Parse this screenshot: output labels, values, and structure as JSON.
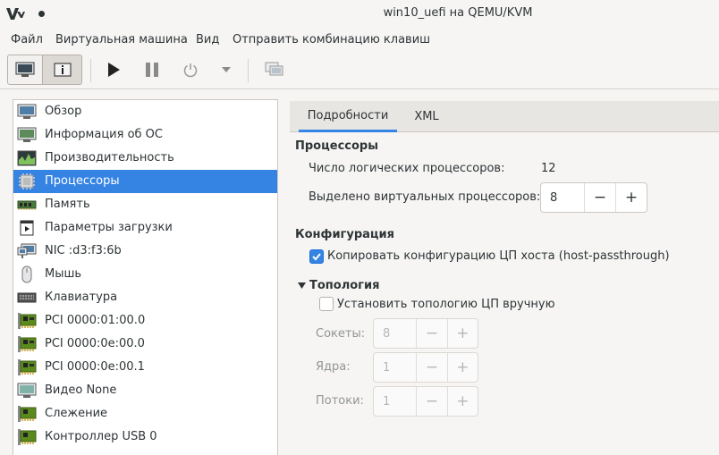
{
  "window": {
    "title": "win10_uefi на QEMU/KVM"
  },
  "menu": [
    "Файл",
    "Виртуальная машина",
    "Вид",
    "Отправить комбинацию клавиш"
  ],
  "toolbar": {
    "buttons": [
      "console-view",
      "details-view",
      "run",
      "pause",
      "shutdown",
      "shutdown-menu",
      "snapshots"
    ]
  },
  "sidebar": {
    "items": [
      {
        "label": "Обзор",
        "icon": "overview-monitor-icon"
      },
      {
        "label": "Информация об ОС",
        "icon": "os-info-monitor-icon"
      },
      {
        "label": "Производительность",
        "icon": "performance-graph-icon"
      },
      {
        "label": "Процессоры",
        "icon": "cpu-chip-icon",
        "selected": true
      },
      {
        "label": "Память",
        "icon": "memory-module-icon"
      },
      {
        "label": "Параметры загрузки",
        "icon": "boot-options-icon"
      },
      {
        "label": "NIC :d3:f3:6b",
        "icon": "network-nic-icon"
      },
      {
        "label": "Мышь",
        "icon": "mouse-icon"
      },
      {
        "label": "Клавиатура",
        "icon": "keyboard-icon"
      },
      {
        "label": "PCI 0000:01:00.0",
        "icon": "pci-card-icon"
      },
      {
        "label": "PCI 0000:0e:00.0",
        "icon": "pci-card-icon"
      },
      {
        "label": "PCI 0000:0e:00.1",
        "icon": "pci-card-icon"
      },
      {
        "label": "Видео None",
        "icon": "video-monitor-icon"
      },
      {
        "label": "Слежение",
        "icon": "tracking-card-icon"
      },
      {
        "label": "Контроллер USB 0",
        "icon": "usb-controller-icon"
      }
    ]
  },
  "tabs": [
    {
      "label": "Подробности",
      "active": true
    },
    {
      "label": "XML",
      "active": false
    }
  ],
  "processors": {
    "section_title": "Процессоры",
    "logical_label": "Число логических процессоров:",
    "logical_value": "12",
    "vcpu_label": "Выделено виртуальных процессоров:",
    "vcpu_value": "8",
    "minus": "−",
    "plus": "+"
  },
  "configuration": {
    "section_title": "Конфигурация",
    "copy_host_label": "Копировать конфигурацию ЦП хоста (host-passthrough)",
    "copy_host_checked": true
  },
  "topology": {
    "section_title": "Топология",
    "manual_label": "Установить топологию ЦП вручную",
    "manual_checked": false,
    "sockets_label": "Сокеты:",
    "sockets_value": "8",
    "cores_label": "Ядра:",
    "cores_value": "1",
    "threads_label": "Потоки:",
    "threads_value": "1"
  },
  "colors": {
    "accent": "#3584e4",
    "pci_green": "#5a8a1e"
  }
}
